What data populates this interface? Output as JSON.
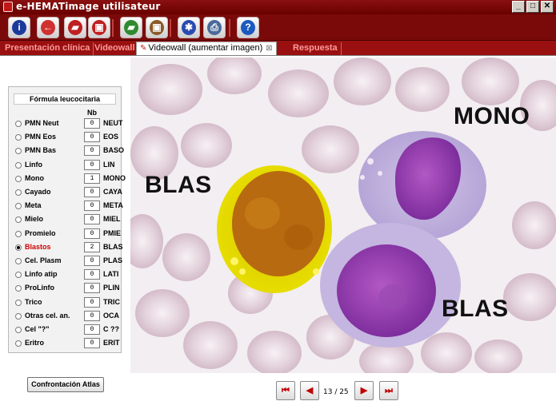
{
  "window": {
    "title": "e-HEMATimage utilisateur",
    "minimize_glyph": "_",
    "maximize_glyph": "□",
    "close_glyph": "✕"
  },
  "toolbar": {
    "buttons": [
      {
        "name": "info-button",
        "icon": "info-icon",
        "glyph": "i",
        "color": "#1a3b9c"
      },
      {
        "name": "back-button",
        "icon": "back-arrow-icon",
        "glyph": "←",
        "color": "#d03030"
      },
      {
        "name": "folder-open-button",
        "icon": "folder-icon",
        "glyph": "▰",
        "color": "#c02020"
      },
      {
        "name": "book-button",
        "icon": "book-icon",
        "glyph": "▣",
        "color": "#c02020"
      },
      {
        "name": "green-folder-button",
        "icon": "green-folder-icon",
        "glyph": "▰",
        "color": "#2f8a2f"
      },
      {
        "name": "brown-book-button",
        "icon": "brown-book-icon",
        "glyph": "▣",
        "color": "#8a5a2a"
      },
      {
        "name": "settings-button",
        "icon": "gear-icon",
        "glyph": "✱",
        "color": "#2a4ab0"
      },
      {
        "name": "print-button",
        "icon": "printer-icon",
        "glyph": "⎙",
        "color": "#4a6a9a"
      },
      {
        "name": "help-button",
        "icon": "help-icon",
        "glyph": "?",
        "color": "#1a5ac0"
      }
    ]
  },
  "tabs": [
    {
      "label": "Presentación clínica",
      "active": false
    },
    {
      "label": "Videowall",
      "active": false
    },
    {
      "label": "Videowall (aumentar imagen)",
      "active": true
    },
    {
      "label": "Respuesta",
      "active": false
    }
  ],
  "formula": {
    "title": "Fórmula leucocitaria",
    "nb_header": "Nb",
    "rows": [
      {
        "label": "PMN Neut",
        "value": "0",
        "code": "NEUT",
        "selected": false
      },
      {
        "label": "PMN Eos",
        "value": "0",
        "code": "EOS",
        "selected": false
      },
      {
        "label": "PMN Bas",
        "value": "0",
        "code": "BASO",
        "selected": false
      },
      {
        "label": "Linfo",
        "value": "0",
        "code": "LIN",
        "selected": false
      },
      {
        "label": "Mono",
        "value": "1",
        "code": "MONO",
        "selected": false
      },
      {
        "label": "Cayado",
        "value": "0",
        "code": "CAYA",
        "selected": false
      },
      {
        "label": "Meta",
        "value": "0",
        "code": "META",
        "selected": false
      },
      {
        "label": "Mielo",
        "value": "0",
        "code": "MIEL",
        "selected": false
      },
      {
        "label": "Promielo",
        "value": "0",
        "code": "PMIE",
        "selected": false
      },
      {
        "label": "Blastos",
        "value": "2",
        "code": "BLAS",
        "selected": true
      },
      {
        "label": "Cel. Plasm",
        "value": "0",
        "code": "PLAS",
        "selected": false
      },
      {
        "label": "Linfo atip",
        "value": "0",
        "code": "LATI",
        "selected": false
      },
      {
        "label": "ProLinfo",
        "value": "0",
        "code": "PLIN",
        "selected": false
      },
      {
        "label": "Trico",
        "value": "0",
        "code": "TRIC",
        "selected": false
      },
      {
        "label": "Otras cel. an.",
        "value": "0",
        "code": "OCA",
        "selected": false
      },
      {
        "label": "Cel \"?\"",
        "value": "0",
        "code": "C ??",
        "selected": false
      },
      {
        "label": "Eritro",
        "value": "0",
        "code": "ERIT",
        "selected": false
      }
    ]
  },
  "atlas_button": "Confrontación Atlas",
  "image": {
    "labels": {
      "blas_left": "BLAS",
      "mono": "MONO",
      "blas_right": "BLAS"
    }
  },
  "navigation": {
    "first_glyph": "⏮",
    "prev_glyph": "◀",
    "next_glyph": "▶",
    "last_glyph": "⏭",
    "counter": "13 / 25"
  },
  "colors": {
    "titlebar": "#7a0a0a",
    "tab_strip": "#9a1010",
    "tab_inactive_text": "#ff9a9a",
    "selected_row": "#d00000",
    "highlight_overlay": "#e6e600"
  }
}
